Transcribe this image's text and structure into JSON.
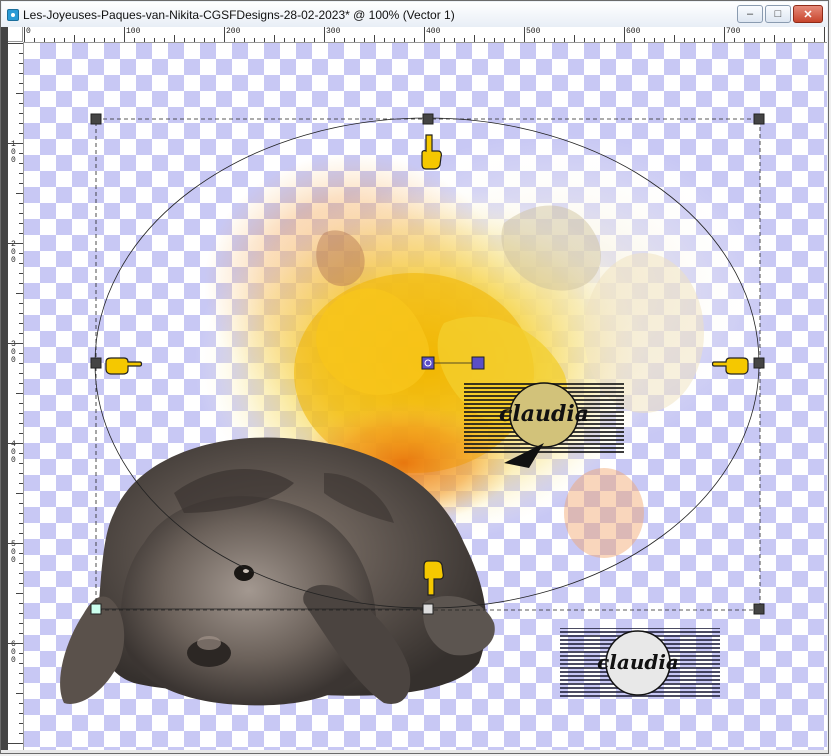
{
  "window": {
    "title": "Les-Joyeuses-Paques-van-Nikita-CGSFDesigns-28-02-2023* @ 100% (Vector 1)",
    "minimize_label": "–",
    "maximize_label": "□",
    "close_label": "✕",
    "icon": "app-icon"
  },
  "ruler": {
    "top_labels": [
      "0",
      "100",
      "200",
      "300",
      "400",
      "500",
      "600",
      "700"
    ],
    "left_labels": [
      "100",
      "200",
      "300",
      "400",
      "500",
      "600"
    ]
  },
  "canvas": {
    "watermark_main": "claudia",
    "watermark_small": "claudia",
    "checker_colors": [
      "#ffffff",
      "#c8c8f4"
    ],
    "accent_handle": "#5a4fc7",
    "pointer_hand_color": "#f5c800"
  },
  "selection": {
    "shape": "ellipse",
    "handles": [
      "top-left",
      "top-center",
      "top-right",
      "middle-left",
      "middle-right",
      "bottom-left",
      "bottom-center",
      "bottom-right",
      "rotation",
      "pivot"
    ]
  }
}
